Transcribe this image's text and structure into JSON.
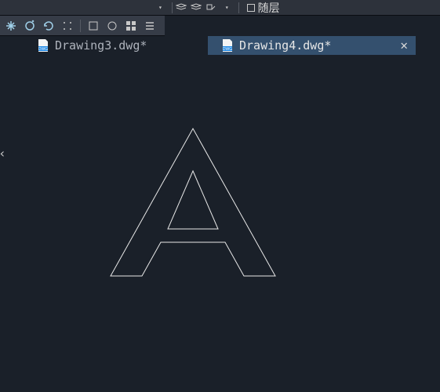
{
  "ribbon": {
    "layer_dropdown_label": "随层"
  },
  "tabs": {
    "0": {
      "label": "Drawing3.dwg*"
    },
    "1": {
      "label": "Drawing4.dwg*"
    }
  },
  "icons": {
    "close": "✕",
    "dropdown": "▾",
    "chevron_left": "‹"
  }
}
